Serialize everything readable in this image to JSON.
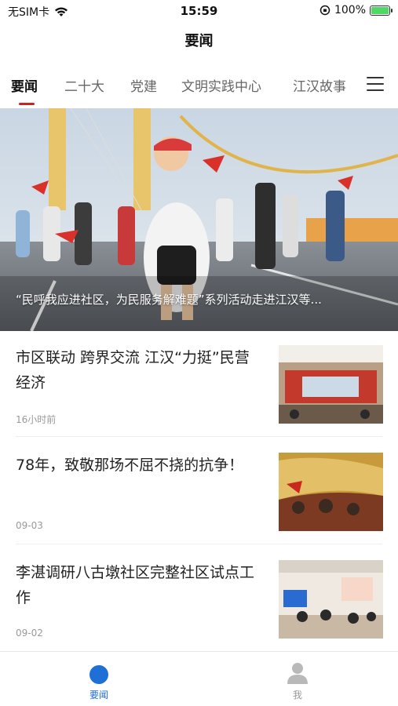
{
  "status_bar": {
    "carrier": "无SIM卡",
    "time": "15:59",
    "battery_percent": "100%",
    "battery_level": 1.0
  },
  "nav": {
    "title": "要闻"
  },
  "tabs": [
    {
      "label": "要闻",
      "active": true
    },
    {
      "label": "二十大",
      "active": false
    },
    {
      "label": "党建",
      "active": false
    },
    {
      "label": "文明实践中心",
      "active": false
    },
    {
      "label": "江汉故事",
      "active": false
    }
  ],
  "banner": {
    "caption": "“民呼我应进社区，为民服务解难题”系列活动走进江汉等..."
  },
  "news": [
    {
      "title": "市区联动 跨界交流 江汉“力挺”民营经济",
      "time": "16小时前"
    },
    {
      "title": "78年，致敬那场不屈不挠的抗争！",
      "time": "09-03"
    },
    {
      "title": "李湛调研八古墩社区完整社区试点工作",
      "time": "09-02"
    }
  ],
  "bottom_nav": [
    {
      "label": "要闻",
      "icon": "home-icon",
      "active": true
    },
    {
      "label": "我",
      "icon": "person-icon",
      "active": false
    }
  ],
  "colors": {
    "accent": "#1e6fd6",
    "tab_underline": "#d0201c"
  }
}
